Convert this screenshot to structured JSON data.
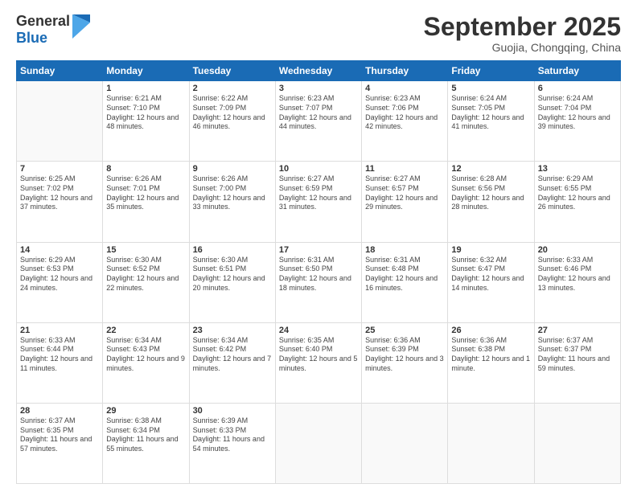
{
  "logo": {
    "general": "General",
    "blue": "Blue"
  },
  "header": {
    "month": "September 2025",
    "location": "Guojia, Chongqing, China"
  },
  "days_of_week": [
    "Sunday",
    "Monday",
    "Tuesday",
    "Wednesday",
    "Thursday",
    "Friday",
    "Saturday"
  ],
  "weeks": [
    [
      {
        "day": "",
        "sunrise": "",
        "sunset": "",
        "daylight": ""
      },
      {
        "day": "1",
        "sunrise": "Sunrise: 6:21 AM",
        "sunset": "Sunset: 7:10 PM",
        "daylight": "Daylight: 12 hours and 48 minutes."
      },
      {
        "day": "2",
        "sunrise": "Sunrise: 6:22 AM",
        "sunset": "Sunset: 7:09 PM",
        "daylight": "Daylight: 12 hours and 46 minutes."
      },
      {
        "day": "3",
        "sunrise": "Sunrise: 6:23 AM",
        "sunset": "Sunset: 7:07 PM",
        "daylight": "Daylight: 12 hours and 44 minutes."
      },
      {
        "day": "4",
        "sunrise": "Sunrise: 6:23 AM",
        "sunset": "Sunset: 7:06 PM",
        "daylight": "Daylight: 12 hours and 42 minutes."
      },
      {
        "day": "5",
        "sunrise": "Sunrise: 6:24 AM",
        "sunset": "Sunset: 7:05 PM",
        "daylight": "Daylight: 12 hours and 41 minutes."
      },
      {
        "day": "6",
        "sunrise": "Sunrise: 6:24 AM",
        "sunset": "Sunset: 7:04 PM",
        "daylight": "Daylight: 12 hours and 39 minutes."
      }
    ],
    [
      {
        "day": "7",
        "sunrise": "Sunrise: 6:25 AM",
        "sunset": "Sunset: 7:02 PM",
        "daylight": "Daylight: 12 hours and 37 minutes."
      },
      {
        "day": "8",
        "sunrise": "Sunrise: 6:26 AM",
        "sunset": "Sunset: 7:01 PM",
        "daylight": "Daylight: 12 hours and 35 minutes."
      },
      {
        "day": "9",
        "sunrise": "Sunrise: 6:26 AM",
        "sunset": "Sunset: 7:00 PM",
        "daylight": "Daylight: 12 hours and 33 minutes."
      },
      {
        "day": "10",
        "sunrise": "Sunrise: 6:27 AM",
        "sunset": "Sunset: 6:59 PM",
        "daylight": "Daylight: 12 hours and 31 minutes."
      },
      {
        "day": "11",
        "sunrise": "Sunrise: 6:27 AM",
        "sunset": "Sunset: 6:57 PM",
        "daylight": "Daylight: 12 hours and 29 minutes."
      },
      {
        "day": "12",
        "sunrise": "Sunrise: 6:28 AM",
        "sunset": "Sunset: 6:56 PM",
        "daylight": "Daylight: 12 hours and 28 minutes."
      },
      {
        "day": "13",
        "sunrise": "Sunrise: 6:29 AM",
        "sunset": "Sunset: 6:55 PM",
        "daylight": "Daylight: 12 hours and 26 minutes."
      }
    ],
    [
      {
        "day": "14",
        "sunrise": "Sunrise: 6:29 AM",
        "sunset": "Sunset: 6:53 PM",
        "daylight": "Daylight: 12 hours and 24 minutes."
      },
      {
        "day": "15",
        "sunrise": "Sunrise: 6:30 AM",
        "sunset": "Sunset: 6:52 PM",
        "daylight": "Daylight: 12 hours and 22 minutes."
      },
      {
        "day": "16",
        "sunrise": "Sunrise: 6:30 AM",
        "sunset": "Sunset: 6:51 PM",
        "daylight": "Daylight: 12 hours and 20 minutes."
      },
      {
        "day": "17",
        "sunrise": "Sunrise: 6:31 AM",
        "sunset": "Sunset: 6:50 PM",
        "daylight": "Daylight: 12 hours and 18 minutes."
      },
      {
        "day": "18",
        "sunrise": "Sunrise: 6:31 AM",
        "sunset": "Sunset: 6:48 PM",
        "daylight": "Daylight: 12 hours and 16 minutes."
      },
      {
        "day": "19",
        "sunrise": "Sunrise: 6:32 AM",
        "sunset": "Sunset: 6:47 PM",
        "daylight": "Daylight: 12 hours and 14 minutes."
      },
      {
        "day": "20",
        "sunrise": "Sunrise: 6:33 AM",
        "sunset": "Sunset: 6:46 PM",
        "daylight": "Daylight: 12 hours and 13 minutes."
      }
    ],
    [
      {
        "day": "21",
        "sunrise": "Sunrise: 6:33 AM",
        "sunset": "Sunset: 6:44 PM",
        "daylight": "Daylight: 12 hours and 11 minutes."
      },
      {
        "day": "22",
        "sunrise": "Sunrise: 6:34 AM",
        "sunset": "Sunset: 6:43 PM",
        "daylight": "Daylight: 12 hours and 9 minutes."
      },
      {
        "day": "23",
        "sunrise": "Sunrise: 6:34 AM",
        "sunset": "Sunset: 6:42 PM",
        "daylight": "Daylight: 12 hours and 7 minutes."
      },
      {
        "day": "24",
        "sunrise": "Sunrise: 6:35 AM",
        "sunset": "Sunset: 6:40 PM",
        "daylight": "Daylight: 12 hours and 5 minutes."
      },
      {
        "day": "25",
        "sunrise": "Sunrise: 6:36 AM",
        "sunset": "Sunset: 6:39 PM",
        "daylight": "Daylight: 12 hours and 3 minutes."
      },
      {
        "day": "26",
        "sunrise": "Sunrise: 6:36 AM",
        "sunset": "Sunset: 6:38 PM",
        "daylight": "Daylight: 12 hours and 1 minute."
      },
      {
        "day": "27",
        "sunrise": "Sunrise: 6:37 AM",
        "sunset": "Sunset: 6:37 PM",
        "daylight": "Daylight: 11 hours and 59 minutes."
      }
    ],
    [
      {
        "day": "28",
        "sunrise": "Sunrise: 6:37 AM",
        "sunset": "Sunset: 6:35 PM",
        "daylight": "Daylight: 11 hours and 57 minutes."
      },
      {
        "day": "29",
        "sunrise": "Sunrise: 6:38 AM",
        "sunset": "Sunset: 6:34 PM",
        "daylight": "Daylight: 11 hours and 55 minutes."
      },
      {
        "day": "30",
        "sunrise": "Sunrise: 6:39 AM",
        "sunset": "Sunset: 6:33 PM",
        "daylight": "Daylight: 11 hours and 54 minutes."
      },
      {
        "day": "",
        "sunrise": "",
        "sunset": "",
        "daylight": ""
      },
      {
        "day": "",
        "sunrise": "",
        "sunset": "",
        "daylight": ""
      },
      {
        "day": "",
        "sunrise": "",
        "sunset": "",
        "daylight": ""
      },
      {
        "day": "",
        "sunrise": "",
        "sunset": "",
        "daylight": ""
      }
    ]
  ]
}
